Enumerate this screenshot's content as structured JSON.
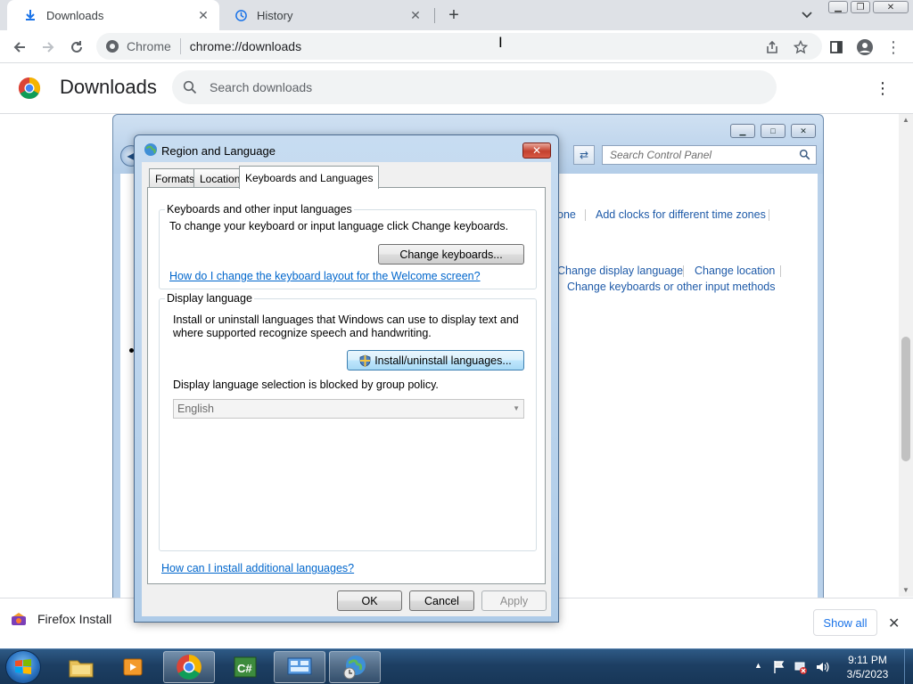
{
  "browser": {
    "tabs": [
      {
        "title": "Downloads",
        "active": true
      },
      {
        "title": "History",
        "active": false
      }
    ],
    "omnibox": {
      "chip": "Chrome",
      "url": "chrome://downloads"
    }
  },
  "downloads_page": {
    "title": "Downloads",
    "search_placeholder": "Search downloads"
  },
  "download_bar": {
    "item_name": "Firefox Install",
    "show_all": "Show all"
  },
  "control_panel": {
    "search_placeholder": "Search Control Panel",
    "links": {
      "time_zone_tail": "one",
      "add_clocks": "Add clocks for different time zones",
      "change_display_language": "Change display language",
      "change_location": "Change location",
      "change_keyboards": "Change keyboards or other input methods"
    }
  },
  "dialog": {
    "title": "Region and Language",
    "tabs": [
      "Formats",
      "Location",
      "Keyboards and Languages"
    ],
    "keyboards_group": {
      "label": "Keyboards and other input languages",
      "description": "To change your keyboard or input language click Change keyboards.",
      "button": "Change keyboards...",
      "link": "How do I change the keyboard layout for the Welcome screen?"
    },
    "display_group": {
      "label": "Display language",
      "description_line1": "Install or uninstall languages that Windows can use to display text and",
      "description_line2": "where supported recognize speech and handwriting.",
      "button": "Install/uninstall languages...",
      "blocked_note": "Display language selection is blocked by group policy.",
      "selected_language": "English"
    },
    "footer_link": "How can I install additional languages?",
    "buttons": {
      "ok": "OK",
      "cancel": "Cancel",
      "apply": "Apply"
    }
  },
  "taskbar": {
    "time": "9:11 PM",
    "date": "3/5/2023",
    "pinned": [
      "windows-explorer",
      "media-player",
      "chrome",
      "csharp-ide",
      "control-panel",
      "region-language"
    ]
  },
  "colors": {
    "chrome_tabstrip": "#dee1e6",
    "link_blue": "#0066cc",
    "cp_link_blue": "#1e5aa8",
    "taskbar_blue": "#1d3f63"
  }
}
